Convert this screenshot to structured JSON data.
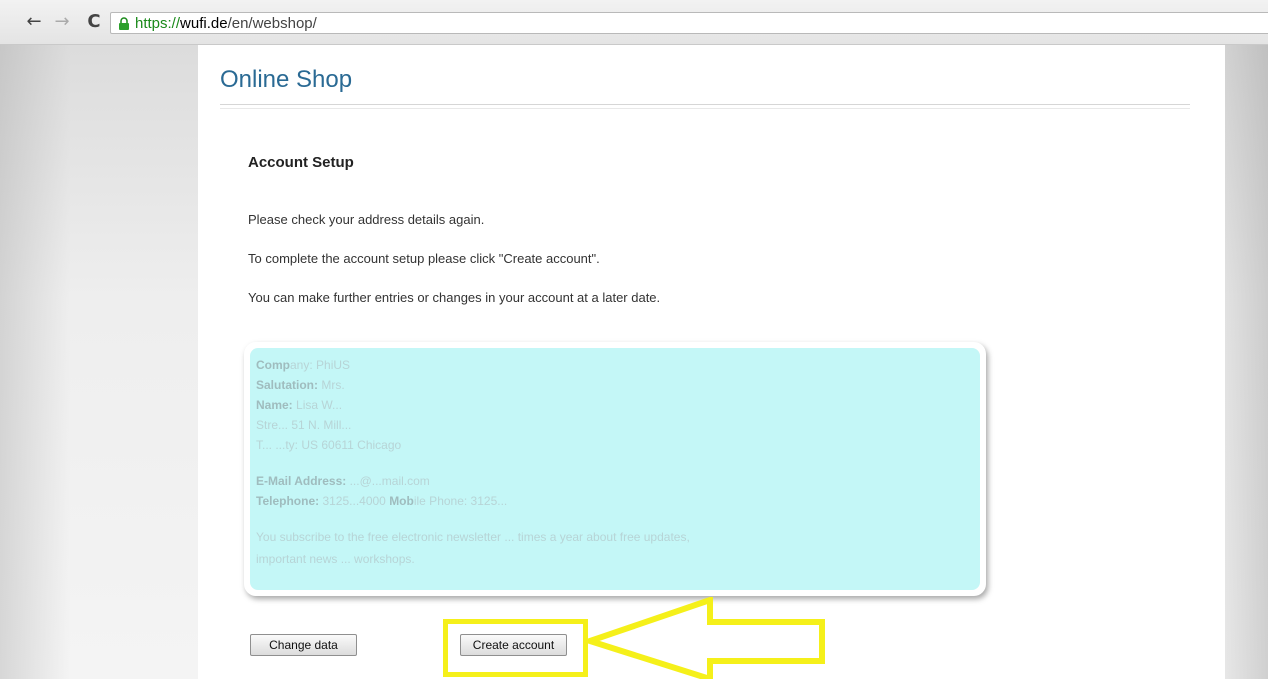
{
  "browser": {
    "url_scheme": "https://",
    "url_host": "wufi.de",
    "url_path": "/en/webshop/"
  },
  "page": {
    "title": "Online Shop",
    "section_heading": "Account Setup",
    "paragraph_1": "Please check your address details again.",
    "paragraph_2": "To complete the account setup please click \"Create account\".",
    "paragraph_3": "You can make further entries or changes in your account at a later date."
  },
  "summary": {
    "company_label": "Comp",
    "company_value": "any: PhiUS",
    "salutation_label": "Salutation:",
    "salutation_value": " Mrs.",
    "name_label": "Name:",
    "name_value": " Lisa W...",
    "street_value": "Stre... 51 N. Mill...",
    "city_value": "T... ...ty: US 60611 Chicago",
    "email_label": "E-Mail Address:",
    "email_value": " ...@...mail.com",
    "telephone_label": "Telephone:",
    "telephone_value": " 3125...4000 ",
    "mobile_label": "Mob",
    "mobile_value": "ile Phone: 3125...",
    "newsletter_line_1": "You subscribe to the free electronic newsletter ... times a year about free updates,",
    "newsletter_line_2": "important news ... workshops."
  },
  "buttons": {
    "change_data": "Change data",
    "create_account": "Create account"
  },
  "colors": {
    "title": "#2a6a94",
    "summary_fill": "#c4f7f7",
    "annotation": "#f5f01a"
  }
}
